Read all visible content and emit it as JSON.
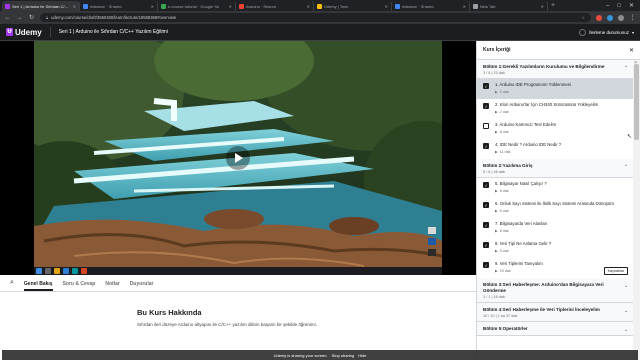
{
  "browser": {
    "tabs": [
      {
        "label": "Seri 1 | Arduino ile Sıfırdan C/C++",
        "active": true,
        "color": "#a435f0"
      },
      {
        "label": "Instance · Shared",
        "active": false,
        "color": "#4285f4"
      },
      {
        "label": "e-course tutorial · Google Se",
        "active": false,
        "color": "#34a853"
      },
      {
        "label": "Arduino · Search",
        "active": false,
        "color": "#ea4335"
      },
      {
        "label": "Udemy | Tech",
        "active": false,
        "color": "#fbbc05"
      },
      {
        "label": "Instance · Shared",
        "active": false,
        "color": "#4285f4"
      },
      {
        "label": "New Tab",
        "active": false,
        "color": "#9aa0a6"
      }
    ],
    "url": "udemy.com/course/draft/3550480/learn/lecture/19558368#overview",
    "new_tab": "+",
    "window_controls": [
      "–",
      "□",
      "✕"
    ]
  },
  "header": {
    "logo": "Udemy",
    "course_title": "Seri 1 | Arduino ile Sıfırdan C/C++ Yazılım Eğitimi",
    "progress_label": "İlerleme durumunuz"
  },
  "course_tabs": [
    "Genel Bakış",
    "Soru & Cevap",
    "Notlar",
    "Duyurular"
  ],
  "overview": {
    "title": "Bu Kurs Hakkında",
    "text": "Sıfırdan ileri düzeye Arduino altyapısı ile C/C++ yazılım dilinin başarılı bir şekilde öğrenimi."
  },
  "sidebar": {
    "title": "Kurs İçeriği",
    "close": "✕",
    "sections": [
      {
        "title": "Bölüm 1:Gerekli Yazılımların Kurulumu ve Bilgilendirme",
        "meta": "3 / 4 | 23 dak",
        "expanded": true,
        "lessons": [
          {
            "title": "1. Arduino IDE Programının Yüklenmesi",
            "meta": "2 dak",
            "checked": true,
            "current": true
          },
          {
            "title": "2. Klon Arduino'lar İçin CH340 Sürücüsünü Yükleyelim",
            "meta": "2 dak",
            "checked": true,
            "current": false
          },
          {
            "title": "3. Arduino Kartımızı Test Edelim",
            "meta": "8 dak",
            "checked": false,
            "current": false
          },
          {
            "title": "4. IDE Nedir ? Arduino IDE Nedir ?",
            "meta": "11 dak",
            "checked": true,
            "current": false
          }
        ]
      },
      {
        "title": "Bölüm 2:Yazılıma Giriş",
        "meta": "5 / 6 | 46 dak",
        "expanded": true,
        "lessons": [
          {
            "title": "5. Bilgisayar Nasıl Çalışır ?",
            "meta": "8 dak",
            "checked": true,
            "current": false
          },
          {
            "title": "6. Onluk Sayı Sistemi ile İkilik Sayı Sistemi Arasında Dönüşüm",
            "meta": "6 dak",
            "checked": true,
            "current": false
          },
          {
            "title": "7. Bilgisayarda Veri Alanları",
            "meta": "8 dak",
            "checked": true,
            "current": false
          },
          {
            "title": "8. Veri Tipi Ne Anlama Gelir ?",
            "meta": "5 dak",
            "checked": true,
            "current": false
          },
          {
            "title": "9. Veri Tiplerini Tanıyalım",
            "meta": "23 dak",
            "checked": true,
            "current": false,
            "resources": "Kaynaklar"
          }
        ]
      },
      {
        "title": "Bölüm 3:Seri Haberleşme: Arduino'dan Bilgisayara Veri Gönderme",
        "meta": "1 / 1 | 16 dak",
        "expanded": false,
        "lessons": []
      },
      {
        "title": "Bölüm 4:Seri Haberleşme ile Veri Tiplerini İnceleyelim",
        "meta": "10 / 10 | 1 sa 37 dak",
        "expanded": false,
        "lessons": []
      },
      {
        "title": "Bölüm 5:Operatörler",
        "meta": "",
        "expanded": false,
        "lessons": []
      }
    ]
  },
  "overlay": {
    "text": "Udemy is sharing your screen.",
    "stop": "Stop sharing",
    "hide": "Hide"
  }
}
